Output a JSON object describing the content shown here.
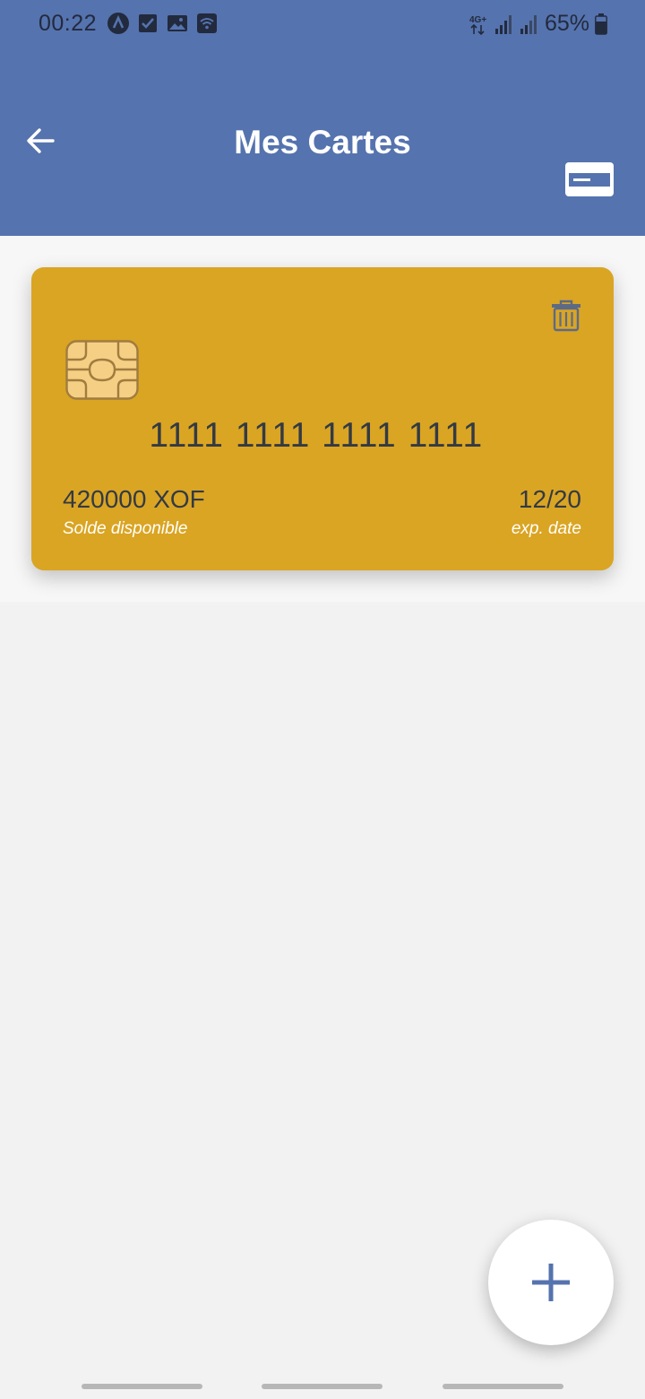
{
  "status_bar": {
    "time": "00:22",
    "network": "4G+",
    "battery": "65%"
  },
  "header": {
    "title": "Mes Cartes",
    "background_color": "#5573ae"
  },
  "card": {
    "number": "1111 1111 1111 1111",
    "balance": "420000 XOF",
    "balance_label": "Solde disponible",
    "expiry": "12/20",
    "expiry_label": "exp. date",
    "color": "#daa523"
  },
  "fab": {
    "icon": "plus-icon"
  }
}
